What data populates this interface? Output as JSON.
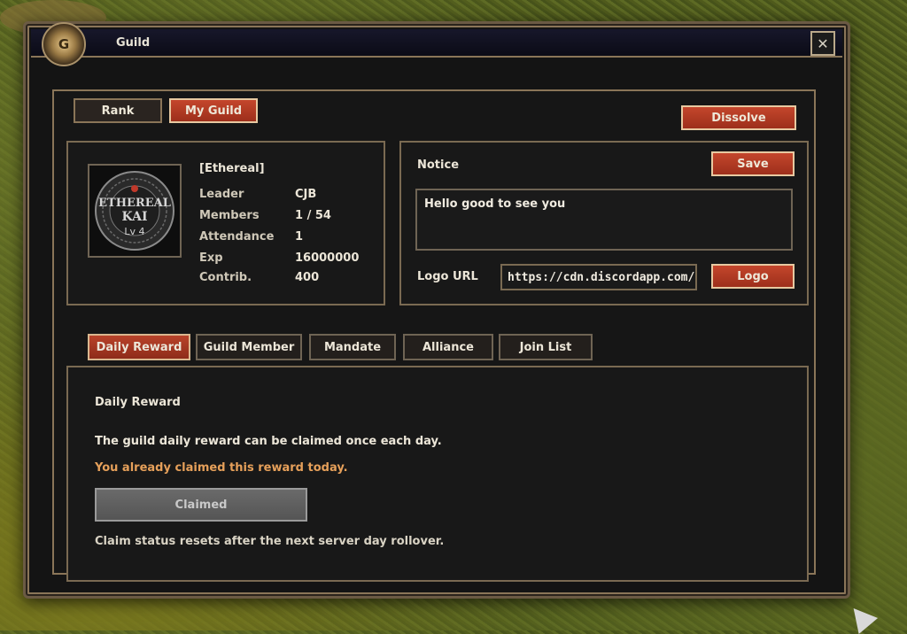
{
  "window": {
    "title": "Guild",
    "emblem": "G",
    "close_glyph": "✕"
  },
  "top_tabs": [
    {
      "label": "Rank"
    },
    {
      "label": "My Guild"
    }
  ],
  "dissolve_label": "Dissolve",
  "guild": {
    "name": "[Ethereal]",
    "logo_text": {
      "line1": "ETHEREAL",
      "line2": "KAI",
      "line3": "Lv 4"
    },
    "fields": [
      {
        "label": "Leader",
        "value": "CJB"
      },
      {
        "label": "Members",
        "value": "1 / 54"
      },
      {
        "label": "Attendance",
        "value": "1"
      },
      {
        "label": "Exp",
        "value": "16000000"
      },
      {
        "label": "Contrib.",
        "value": "400"
      }
    ]
  },
  "notice": {
    "title": "Notice",
    "save_label": "Save",
    "text": "Hello good to see you",
    "logo_url_label": "Logo URL",
    "logo_url_value": "https://cdn.discordapp.com/at",
    "logo_button_label": "Logo"
  },
  "tabs": [
    {
      "label": "Daily Reward",
      "active": true
    },
    {
      "label": "Guild Member",
      "active": false
    },
    {
      "label": "Mandate",
      "active": false
    },
    {
      "label": "Alliance",
      "active": false
    },
    {
      "label": "Join List",
      "active": false
    }
  ],
  "daily_reward": {
    "heading": "Daily Reward",
    "description": "The guild daily reward can be claimed once each day.",
    "status": "You already claimed this reward today.",
    "button_label": "Claimed",
    "footnote": "Claim status resets after the next server day rollover."
  },
  "colors": {
    "accent_red": "#b9432a",
    "frame": "#8a7558",
    "status_orange": "#e6a05a"
  }
}
